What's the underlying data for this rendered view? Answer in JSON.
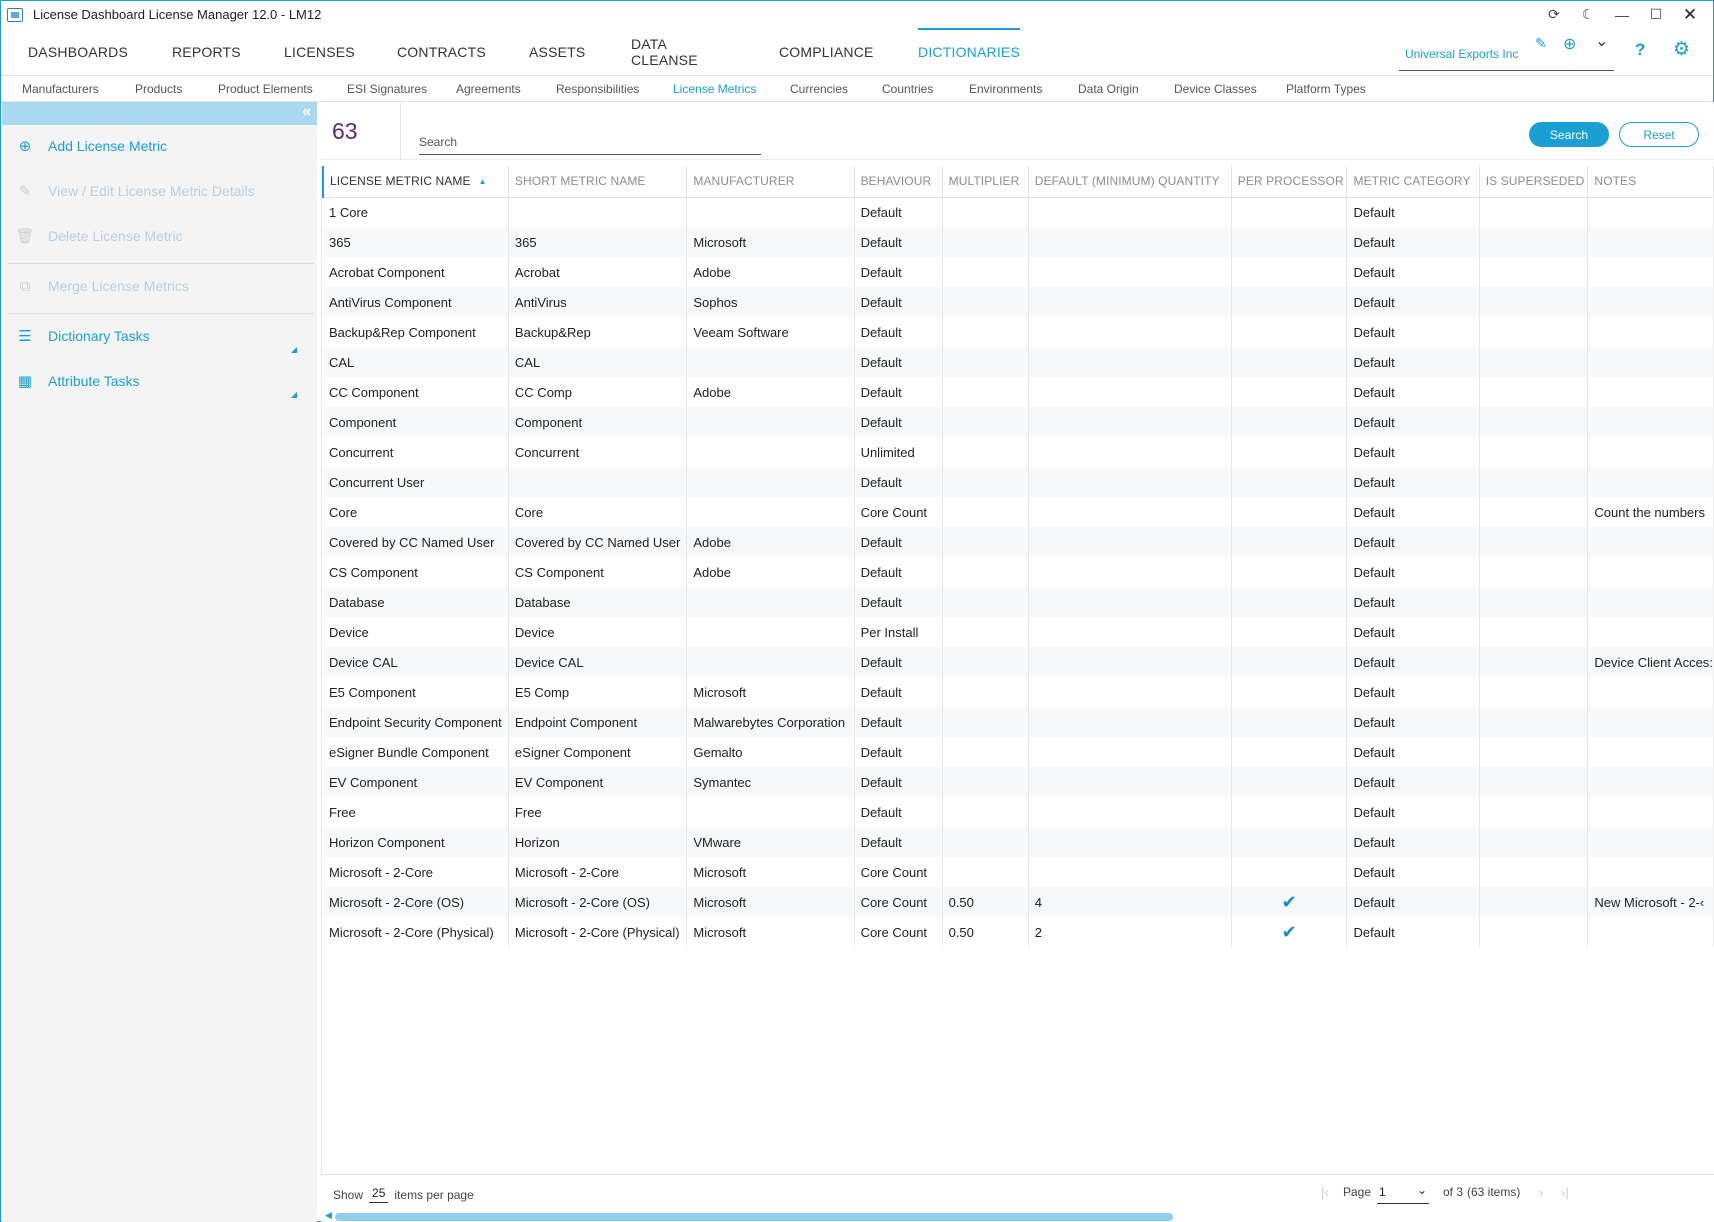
{
  "window": {
    "title": "License Dashboard License Manager 12.0 - LM12",
    "controls": {
      "refresh": "⟳",
      "theme": "☾",
      "minimize": "—",
      "maximize": "☐",
      "close": "✕"
    }
  },
  "mainnav": {
    "tabs": [
      {
        "label": "DASHBOARDS"
      },
      {
        "label": "REPORTS"
      },
      {
        "label": "LICENSES"
      },
      {
        "label": "CONTRACTS"
      },
      {
        "label": "ASSETS"
      },
      {
        "label": "DATA CLEANSE"
      },
      {
        "label": "COMPLIANCE"
      },
      {
        "label": "DICTIONARIES",
        "active": true
      }
    ],
    "organization": "Universal Exports Inc",
    "icons": {
      "edit": "✎",
      "add": "⊕",
      "dropdown": "⌄",
      "help": "?",
      "settings": "⚙"
    }
  },
  "subnav": {
    "items": [
      {
        "label": "Manufacturers"
      },
      {
        "label": "Products"
      },
      {
        "label": "Product Elements"
      },
      {
        "label": "ESI Signatures"
      },
      {
        "label": "Agreements"
      },
      {
        "label": "Responsibilities"
      },
      {
        "label": "License Metrics",
        "active": true
      },
      {
        "label": "Currencies"
      },
      {
        "label": "Countries"
      },
      {
        "label": "Environments"
      },
      {
        "label": "Data Origin"
      },
      {
        "label": "Device Classes"
      },
      {
        "label": "Platform Types"
      }
    ]
  },
  "sidebar": {
    "collapse_glyph": "«",
    "items": [
      {
        "label": "Add License Metric",
        "icon": "plus-circle-icon",
        "glyph": "⊕",
        "enabled": true
      },
      {
        "label": "View / Edit License Metric Details",
        "icon": "pencil-icon",
        "glyph": "✎",
        "enabled": false
      },
      {
        "label": "Delete License Metric",
        "icon": "trash-icon",
        "glyph": "🗑",
        "enabled": false
      },
      {
        "label": "Merge License Metrics",
        "icon": "merge-icon",
        "glyph": "⧉",
        "enabled": false
      },
      {
        "label": "Dictionary Tasks",
        "icon": "list-icon",
        "glyph": "☰",
        "enabled": true
      },
      {
        "label": "Attribute Tasks",
        "icon": "attribute-icon",
        "glyph": "▦",
        "enabled": true
      }
    ]
  },
  "toolbar": {
    "count": "63",
    "search_placeholder": "Search",
    "search_value": "",
    "search_label": "Search",
    "reset_label": "Reset"
  },
  "table": {
    "columns": [
      "LICENSE METRIC NAME",
      "SHORT METRIC NAME",
      "MANUFACTURER",
      "BEHAVIOUR",
      "MULTIPLIER",
      "DEFAULT (MINIMUM) QUANTITY",
      "PER PROCESSOR",
      "METRIC CATEGORY",
      "IS SUPERSEDED",
      "NOTES"
    ],
    "sort_glyph": "▲",
    "check_glyph": "✔",
    "rows": [
      [
        "1 Core",
        "",
        "",
        "Default",
        "",
        "",
        false,
        "Default",
        "",
        ""
      ],
      [
        "365",
        "365",
        "Microsoft",
        "Default",
        "",
        "",
        false,
        "Default",
        "",
        ""
      ],
      [
        "Acrobat Component",
        "Acrobat",
        "Adobe",
        "Default",
        "",
        "",
        false,
        "Default",
        "",
        ""
      ],
      [
        "AntiVirus Component",
        "AntiVirus",
        "Sophos",
        "Default",
        "",
        "",
        false,
        "Default",
        "",
        ""
      ],
      [
        "Backup&Rep Component",
        "Backup&Rep",
        "Veeam Software",
        "Default",
        "",
        "",
        false,
        "Default",
        "",
        ""
      ],
      [
        "CAL",
        "CAL",
        "",
        "Default",
        "",
        "",
        false,
        "Default",
        "",
        ""
      ],
      [
        "CC Component",
        "CC Comp",
        "Adobe",
        "Default",
        "",
        "",
        false,
        "Default",
        "",
        ""
      ],
      [
        "Component",
        "Component",
        "",
        "Default",
        "",
        "",
        false,
        "Default",
        "",
        ""
      ],
      [
        "Concurrent",
        "Concurrent",
        "",
        "Unlimited",
        "",
        "",
        false,
        "Default",
        "",
        ""
      ],
      [
        "Concurrent User",
        "",
        "",
        "Default",
        "",
        "",
        false,
        "Default",
        "",
        ""
      ],
      [
        "Core",
        "Core",
        "",
        "Core Count",
        "",
        "",
        false,
        "Default",
        "",
        "Count the numbers"
      ],
      [
        "Covered by CC Named User",
        "Covered by CC Named User",
        "Adobe",
        "Default",
        "",
        "",
        false,
        "Default",
        "",
        ""
      ],
      [
        "CS Component",
        "CS Component",
        "Adobe",
        "Default",
        "",
        "",
        false,
        "Default",
        "",
        ""
      ],
      [
        "Database",
        "Database",
        "",
        "Default",
        "",
        "",
        false,
        "Default",
        "",
        ""
      ],
      [
        "Device",
        "Device",
        "",
        "Per Install",
        "",
        "",
        false,
        "Default",
        "",
        ""
      ],
      [
        "Device CAL",
        "Device CAL",
        "",
        "Default",
        "",
        "",
        false,
        "Default",
        "",
        "Device Client Acces:"
      ],
      [
        "E5 Component",
        "E5 Comp",
        "Microsoft",
        "Default",
        "",
        "",
        false,
        "Default",
        "",
        ""
      ],
      [
        "Endpoint Security Component",
        "Endpoint Component",
        "Malwarebytes Corporation",
        "Default",
        "",
        "",
        false,
        "Default",
        "",
        ""
      ],
      [
        "eSigner Bundle Component",
        "eSigner Component",
        "Gemalto",
        "Default",
        "",
        "",
        false,
        "Default",
        "",
        ""
      ],
      [
        "EV Component",
        "EV Component",
        "Symantec",
        "Default",
        "",
        "",
        false,
        "Default",
        "",
        ""
      ],
      [
        "Free",
        "Free",
        "",
        "Default",
        "",
        "",
        false,
        "Default",
        "",
        ""
      ],
      [
        "Horizon Component",
        "Horizon",
        "VMware",
        "Default",
        "",
        "",
        false,
        "Default",
        "",
        ""
      ],
      [
        "Microsoft - 2-Core",
        "Microsoft - 2-Core",
        "Microsoft",
        "Core Count",
        "",
        "",
        false,
        "Default",
        "",
        ""
      ],
      [
        "Microsoft - 2-Core (OS)",
        "Microsoft - 2-Core (OS)",
        "Microsoft",
        "Core Count",
        "0.50",
        "4",
        true,
        "Default",
        "",
        "New Microsoft - 2-‹"
      ],
      [
        "Microsoft - 2-Core (Physical)",
        "Microsoft - 2-Core (Physical)",
        "Microsoft",
        "Core Count",
        "0.50",
        "2",
        true,
        "Default",
        "",
        ""
      ]
    ]
  },
  "pager": {
    "show_label": "Show",
    "per_page": "25",
    "per_page_label": "items per page",
    "page_label": "Page",
    "page_value": "1",
    "of_label": "of 3",
    "items_label": "(63 items)",
    "first_glyph": "|‹",
    "prev_glyph": "‹",
    "next_glyph": "›",
    "last_glyph": "›|",
    "dropdown_glyph": "⌄"
  },
  "scrollbar": {
    "left_arrow": "◀"
  }
}
